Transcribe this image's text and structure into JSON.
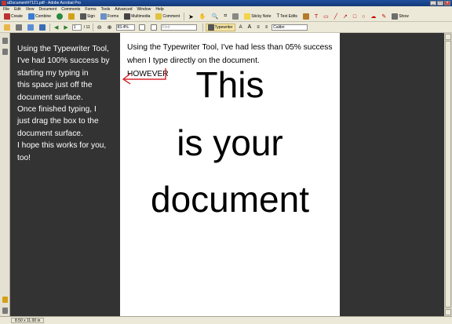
{
  "window": {
    "title": "aDocument#7121.pdf - Adobe Acrobat Pro"
  },
  "menu": [
    "File",
    "Edit",
    "View",
    "Document",
    "Comments",
    "Forms",
    "Tools",
    "Advanced",
    "Window",
    "Help"
  ],
  "toolbar1": {
    "create": "Create",
    "combine": "Combine",
    "sign": "Sign",
    "forms": "Forms",
    "multimedia": "Multimedia",
    "comment": "Comment",
    "sticky_note": "Sticky Note",
    "text_edits": "Text Edits",
    "show": "Show"
  },
  "toolbar2": {
    "page_current": "1",
    "page_total": "/ 11",
    "zoom": "83.4%",
    "find": "Find",
    "typewriter": "Typewriter",
    "font": "Calibri"
  },
  "sidebar_note": "Using the Typewriter Tool,\nI've had 100% success by\nstarting my typing in\nthis space just off the\ndocument surface.\nOnce finished typing, I\njust drag the box to the\ndocument surface.\nI hope this works for you,\ntoo!",
  "document": {
    "typed_text": "Using the Typewriter Tool, I've had less than 05% success\nwhen I type directly on the document.\nHOWEVER",
    "line1": "This",
    "line2": "is your",
    "line3": "document"
  },
  "status": {
    "page_size": "8.50 x 11.00 in"
  },
  "colors": {
    "arrow": "#d6282d",
    "title_bar": "#1f4f9c",
    "toolbar": "#ece9d8",
    "canvas": "#333333"
  }
}
